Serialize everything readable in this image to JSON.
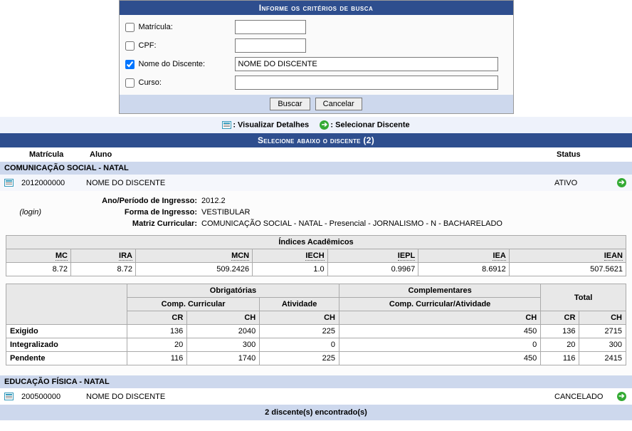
{
  "search": {
    "title": "Informe os critérios de busca",
    "matricula_label": "Matrícula:",
    "matricula_value": "",
    "matricula_checked": false,
    "cpf_label": "CPF:",
    "cpf_value": "",
    "cpf_checked": false,
    "nome_label": "Nome do Discente:",
    "nome_value": "NOME DO DISCENTE",
    "nome_checked": true,
    "curso_label": "Curso:",
    "curso_value": "",
    "curso_checked": false,
    "buscar": "Buscar",
    "cancelar": "Cancelar"
  },
  "legend": {
    "detalhes": ": Visualizar Detalhes",
    "selecionar": ": Selecionar Discente"
  },
  "select_header": "Selecione abaixo o discente (2)",
  "cols": {
    "matricula": "Matrícula",
    "aluno": "Aluno",
    "status": "Status"
  },
  "courses": [
    {
      "title": "COMUNICAÇÃO SOCIAL - NATAL",
      "student": {
        "matricula": "2012000000",
        "nome": "NOME DO DISCENTE",
        "status": "ATIVO"
      },
      "details": {
        "ano_label": "Ano/Período de Ingresso:",
        "ano_value": "2012.2",
        "login": "(login)",
        "forma_label": "Forma de Ingresso:",
        "forma_value": "VESTIBULAR",
        "matriz_label": "Matriz Curricular:",
        "matriz_value": "COMUNICAÇÃO SOCIAL - NATAL - Presencial - JORNALISMO - N - BACHARELADO"
      },
      "indices": {
        "title": "Índices Acadêmicos",
        "heads": [
          "MC",
          "IRA",
          "MCN",
          "IECH",
          "IEPL",
          "IEA",
          "IEAN"
        ],
        "vals": [
          "8.72",
          "8.72",
          "509.2426",
          "1.0",
          "0.9967",
          "8.6912",
          "507.5621"
        ]
      },
      "hours": {
        "obrig": "Obrigatórias",
        "comp_curr": "Comp. Curricular",
        "atividade": "Atividade",
        "compl": "Complementares",
        "comp_curr_ativ": "Comp. Curricular/Atividade",
        "total": "Total",
        "cr": "CR",
        "ch": "CH",
        "rows": [
          {
            "lbl": "Exigido",
            "ccr": "136",
            "cch": "2040",
            "ach": "225",
            "compch": "450",
            "tcr": "136",
            "tch": "2715"
          },
          {
            "lbl": "Integralizado",
            "ccr": "20",
            "cch": "300",
            "ach": "0",
            "compch": "0",
            "tcr": "20",
            "tch": "300"
          },
          {
            "lbl": "Pendente",
            "ccr": "116",
            "cch": "1740",
            "ach": "225",
            "compch": "450",
            "tcr": "116",
            "tch": "2415"
          }
        ]
      }
    },
    {
      "title": "EDUCAÇÃO FÍSICA - NATAL",
      "student": {
        "matricula": "200500000",
        "nome": "NOME DO DISCENTE",
        "status": "CANCELADO"
      }
    }
  ],
  "footer": "2 discente(s) encontrado(s)"
}
